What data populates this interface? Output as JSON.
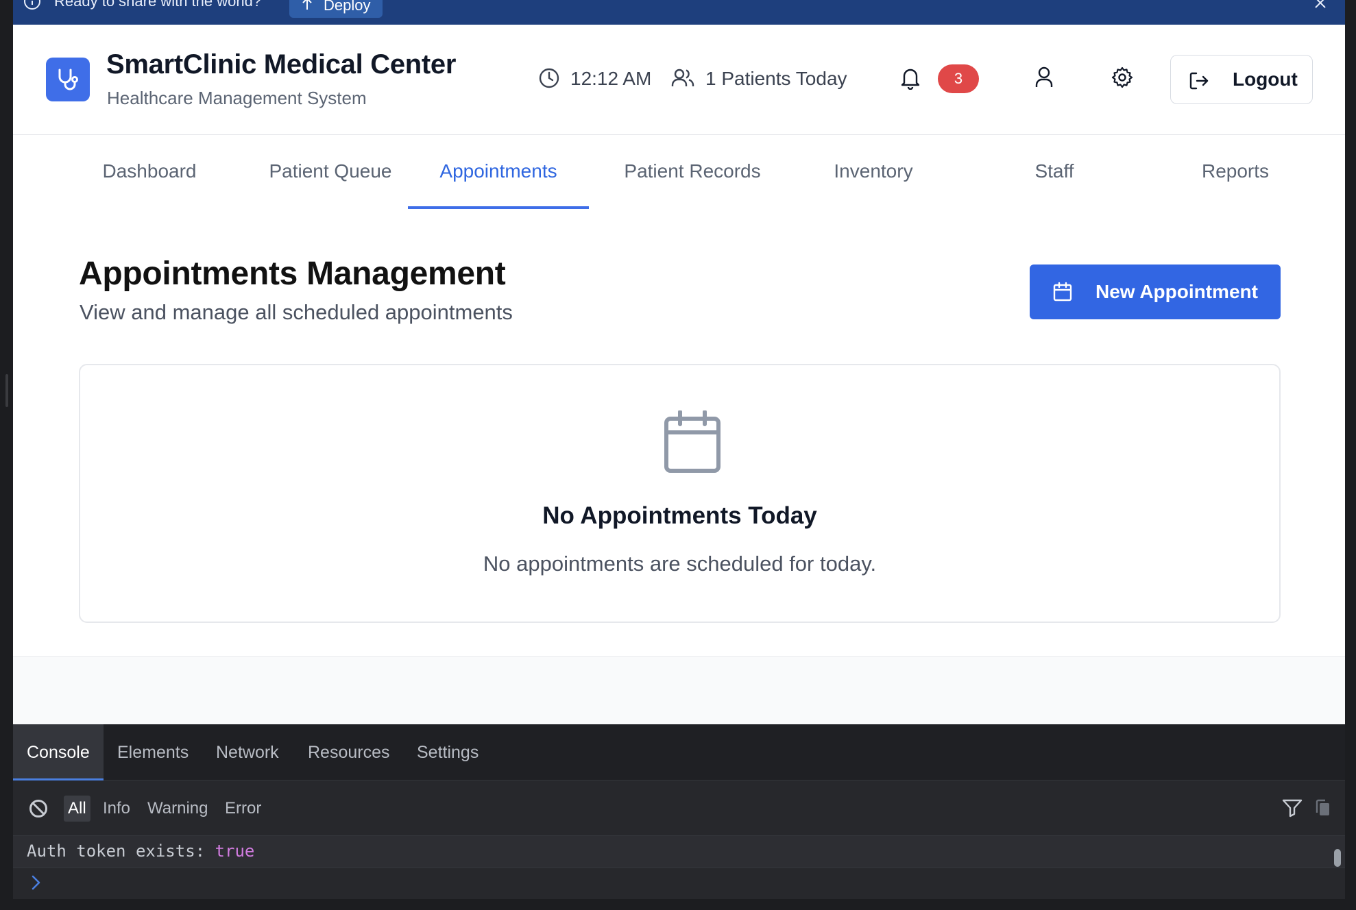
{
  "banner": {
    "text": "Ready to share with the world?",
    "deploy_label": "Deploy"
  },
  "header": {
    "title": "SmartClinic Medical Center",
    "subtitle": "Healthcare Management System",
    "time": "12:12 AM",
    "patients_today": "1 Patients Today",
    "notification_count": "3",
    "logout_label": "Logout"
  },
  "nav": {
    "tabs": [
      {
        "label": "Dashboard"
      },
      {
        "label": "Patient Queue"
      },
      {
        "label": "Appointments"
      },
      {
        "label": "Patient Records"
      },
      {
        "label": "Inventory"
      },
      {
        "label": "Staff"
      },
      {
        "label": "Reports"
      }
    ],
    "active": "Appointments"
  },
  "main": {
    "title": "Appointments Management",
    "subtitle": "View and manage all scheduled appointments",
    "new_button_label": "New Appointment",
    "empty_state": {
      "title": "No Appointments Today",
      "text": "No appointments are scheduled for today."
    }
  },
  "devtools": {
    "tabs": [
      "Console",
      "Elements",
      "Network",
      "Resources",
      "Settings"
    ],
    "active_tab": "Console",
    "filters": [
      "All",
      "Info",
      "Warning",
      "Error"
    ],
    "active_filter": "All",
    "log": {
      "key": "Auth token exists: ",
      "value": "true"
    }
  },
  "colors": {
    "brand": "#3f6ee8",
    "banner_bg": "#1e3f7d",
    "badge": "#e04848",
    "devtools_bg": "#27282c"
  },
  "icons": [
    "info-icon",
    "upload-arrow-icon",
    "close-icon",
    "stethoscope-icon",
    "clock-icon",
    "users-icon",
    "bell-icon",
    "user-icon",
    "gear-icon",
    "logout-icon",
    "calendar-icon",
    "ban-icon",
    "funnel-icon",
    "copy-icon",
    "chevron-right-icon"
  ]
}
